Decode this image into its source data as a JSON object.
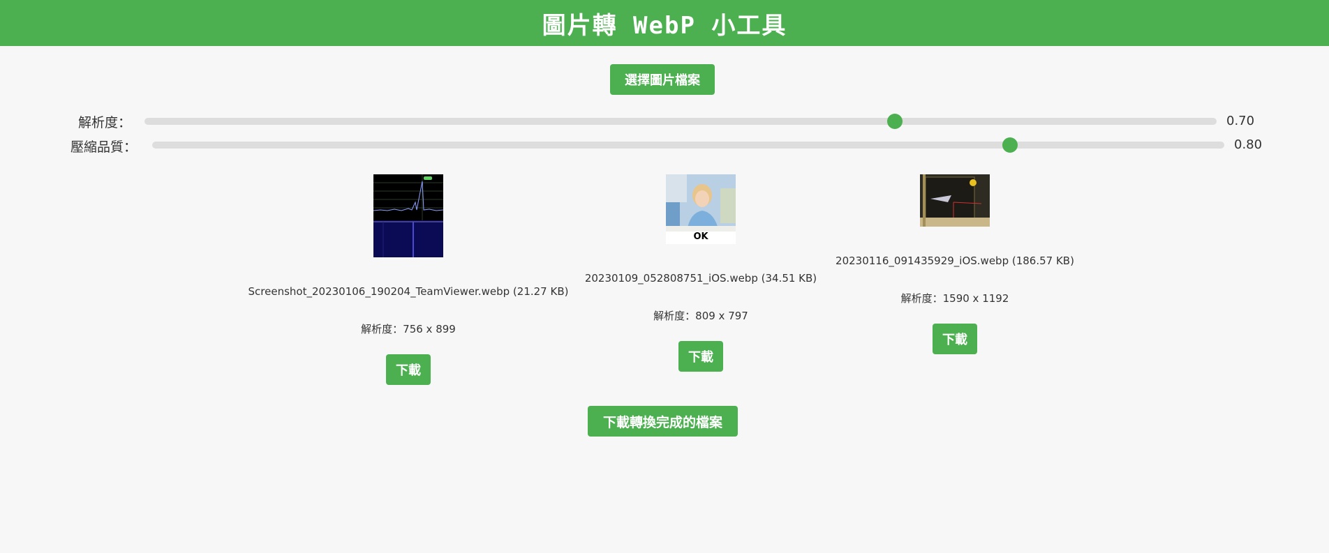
{
  "header": {
    "title": "圖片轉 WebP 小工具"
  },
  "toolbar": {
    "choose_label": "選擇圖片檔案"
  },
  "sliders": [
    {
      "label": "解析度：",
      "value": 0.7,
      "value_text": "0.70"
    },
    {
      "label": "壓縮品質：",
      "value": 0.8,
      "value_text": "0.80"
    }
  ],
  "results": [
    {
      "filename": "Screenshot_20230106_190204_TeamViewer.webp (21.27 KB)",
      "resolution": "解析度：756 x 899",
      "download_label": "下載"
    },
    {
      "filename": "20230109_052808751_iOS.webp (34.51 KB)",
      "resolution": "解析度：809 x 797",
      "download_label": "下載",
      "thumb_caption": "OK"
    },
    {
      "filename": "20230116_091435929_iOS.webp (186.57 KB)",
      "resolution": "解析度：1590 x 1192",
      "download_label": "下載"
    }
  ],
  "footer": {
    "download_all_label": "下載轉換完成的檔案"
  },
  "colors": {
    "accent": "#4caf50",
    "background": "#f7f7f7",
    "track": "#dddddd"
  }
}
